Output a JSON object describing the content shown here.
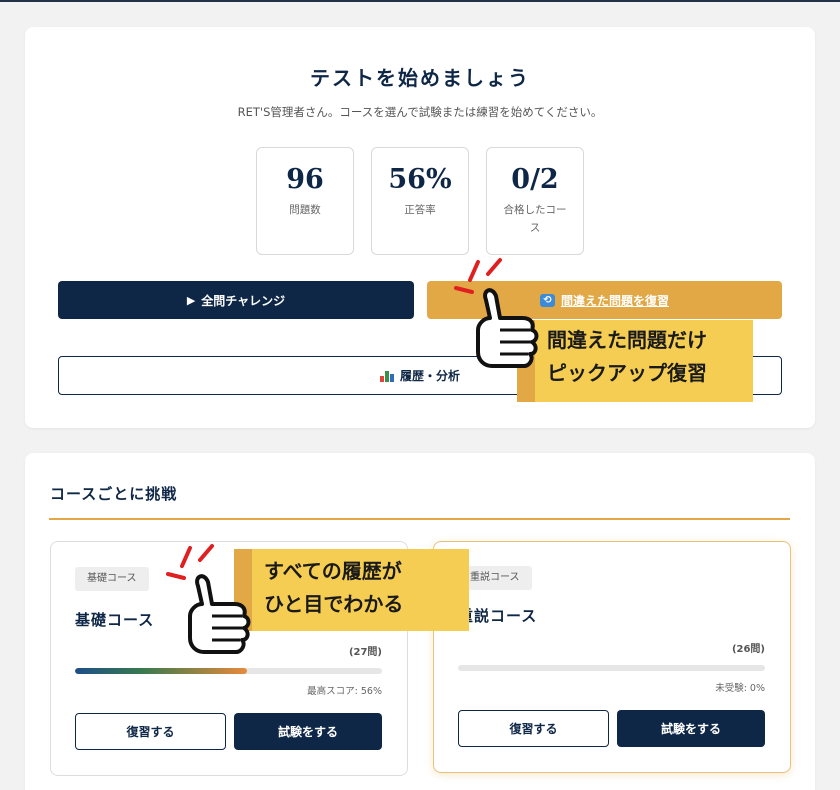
{
  "header": {
    "title": "テストを始めましょう",
    "subtitle": "RET'S管理者さん。コースを選んで試験または練習を始めてください。"
  },
  "stats": [
    {
      "value": "96",
      "label": "問題数"
    },
    {
      "value": "56%",
      "label": "正答率"
    },
    {
      "value": "0/2",
      "label": "合格したコース"
    }
  ],
  "actions": {
    "all_challenge": {
      "icon": "play-icon",
      "label": "全問チャレンジ"
    },
    "review_wrong": {
      "icon": "repeat-icon",
      "label": "間違えた問題を復習"
    },
    "history": {
      "icon": "bar-chart-icon",
      "label": "履歴・分析"
    }
  },
  "courses_section": {
    "title": "コースごとに挑戦",
    "courses": [
      {
        "tag": "基礎コース",
        "name": "基礎コース",
        "question_count": "(27問)",
        "progress": 0.56,
        "score_text": "最高スコア: 56%",
        "review_label": "復習する",
        "exam_label": "試験をする"
      },
      {
        "tag": "重説コース",
        "name": "重説コース",
        "question_count": "(26問)",
        "progress": 0,
        "score_text": "未受験: 0%",
        "review_label": "復習する",
        "exam_label": "試験をする"
      }
    ]
  },
  "callouts": [
    {
      "line1": "間違えた問題だけ",
      "line2": "ピックアップ復習",
      "icon": "thumbs-up-icon"
    },
    {
      "line1": "すべての履歴が",
      "line2": "ひと目でわかる",
      "icon": "thumbs-up-icon"
    }
  ],
  "colors": {
    "navy": "#0f2747",
    "accent_gold": "#e2a845",
    "callout_yellow": "#f5cd52",
    "spark_red": "#e02020"
  }
}
